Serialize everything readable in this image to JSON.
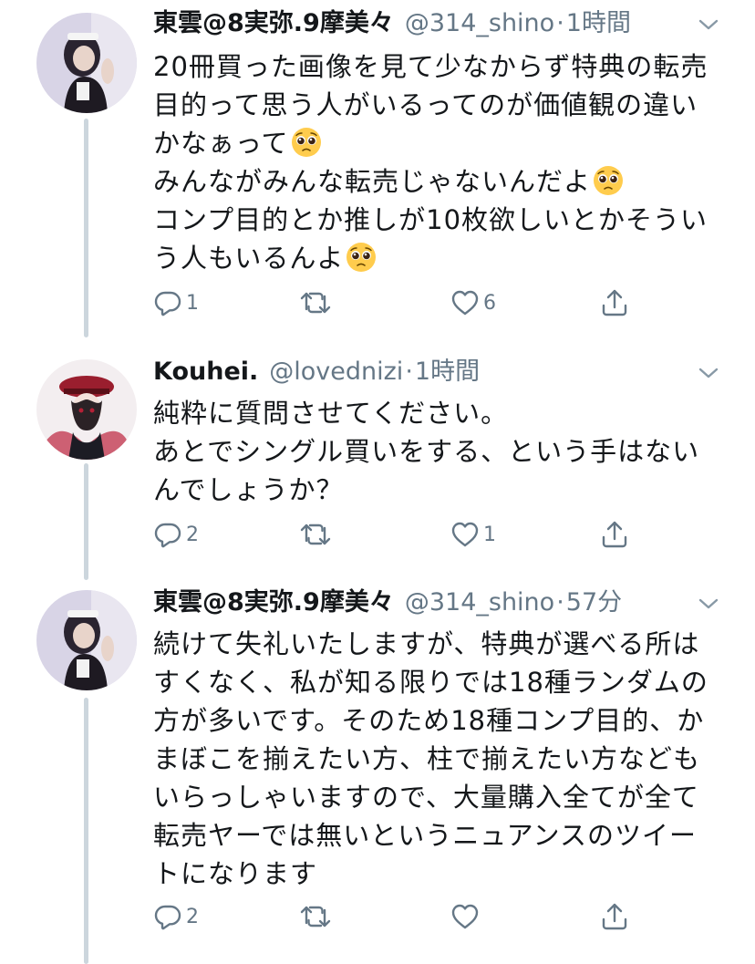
{
  "colors": {
    "secondary_text": "#657786",
    "thread_line": "#ccd6dd",
    "primary_text": "#14171a"
  },
  "tweets": [
    {
      "display_name": "東雲@8実弥.9摩美々",
      "handle": "@314_shino",
      "separator": "·",
      "time": "1時間",
      "lines": [
        "20冊買った画像を見て少なからず特典の転売",
        "目的って思う人がいるってのが価値観の違い",
        "かなぁって",
        "みんながみんな転売じゃないんだよ",
        "コンプ目的とか推しが10枚欲しいとかそうい",
        "う人もいるんよ"
      ],
      "emoji_icon": "pleading-face-emoji",
      "reply_count": "1",
      "retweet_count": "",
      "like_count": "6"
    },
    {
      "display_name": "Kouhei.",
      "handle": "@lovednizi",
      "separator": "·",
      "time": "1時間",
      "lines": [
        "純粋に質問させてください。",
        "あとでシングル買いをする、という手はない",
        "んでしょうか？"
      ],
      "reply_count": "2",
      "retweet_count": "",
      "like_count": "1"
    },
    {
      "display_name": "東雲@8実弥.9摩美々",
      "handle": "@314_shino",
      "separator": "·",
      "time": "57分",
      "lines": [
        "続けて失礼いたしますが、特典が選べる所は",
        "すくなく、私が知る限りでは18種ランダムの",
        "方が多いです。そのため18種コンプ目的、か",
        "まぼこを揃えたい方、柱で揃えたい方なども",
        "いらっしゃいますので、大量購入全てが全て",
        "転売ヤーでは無いというニュアンスのツイー",
        "トになります"
      ],
      "reply_count": "2",
      "retweet_count": "",
      "like_count": ""
    }
  ]
}
